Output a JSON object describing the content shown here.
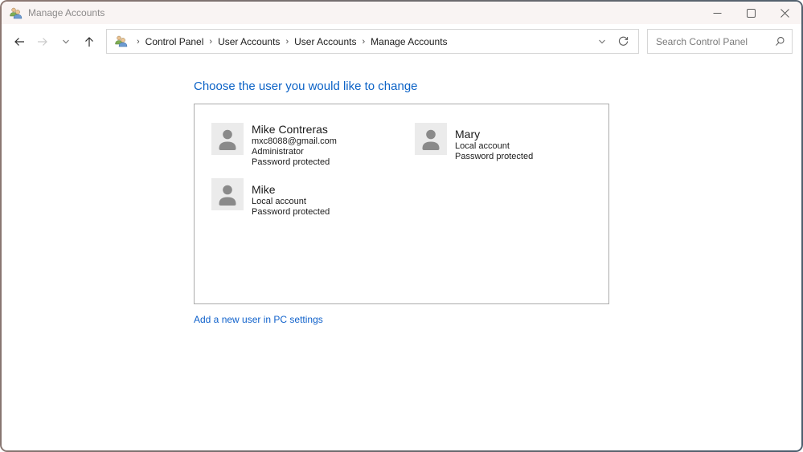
{
  "window": {
    "title": "Manage Accounts"
  },
  "nav": {
    "separator": "›",
    "breadcrumb_items": [
      "Control Panel",
      "User Accounts",
      "User Accounts",
      "Manage Accounts"
    ]
  },
  "search": {
    "placeholder": "Search Control Panel"
  },
  "main": {
    "heading": "Choose the user you would like to change",
    "users": [
      {
        "name": "Mike Contreras",
        "lines": [
          "mxc8088@gmail.com",
          "Administrator",
          "Password protected"
        ]
      },
      {
        "name": "Mary",
        "lines": [
          "Local account",
          "Password protected"
        ]
      },
      {
        "name": "Mike",
        "lines": [
          "Local account",
          "Password protected"
        ]
      }
    ],
    "add_user_link": "Add a new user in PC settings"
  },
  "colors": {
    "heading_blue": "#0b62c6",
    "link_blue": "#0f61cb",
    "titlebar_bg": "#f9f4f3",
    "window_border_left": "#8d7872",
    "window_border_right": "#4c5e6e"
  }
}
